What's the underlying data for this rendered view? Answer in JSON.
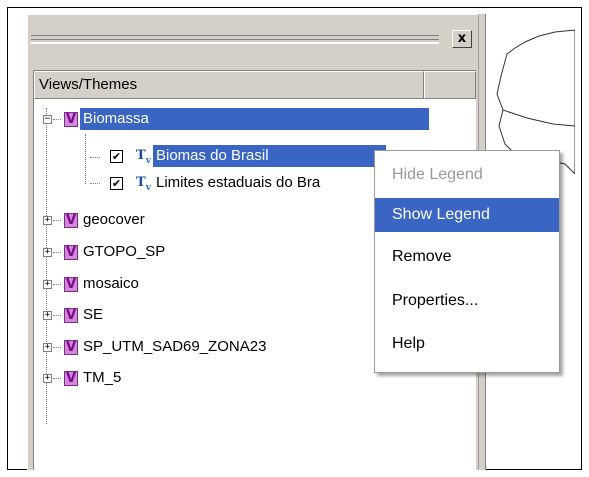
{
  "panel": {
    "close_glyph": "x",
    "column_header": "Views/Themes"
  },
  "tree": {
    "items": [
      {
        "label": "Biomassa",
        "icon": "view-icon",
        "expanded": true,
        "selected": true
      },
      {
        "label": "Biomas do Brasil",
        "icon": "theme-icon",
        "checked": true,
        "selected": true
      },
      {
        "label": "Limites estaduais do Bra",
        "icon": "theme-icon",
        "checked": true
      },
      {
        "label": "geocover",
        "icon": "view-icon",
        "expanded": false
      },
      {
        "label": "GTOPO_SP",
        "icon": "view-icon",
        "expanded": false
      },
      {
        "label": "mosaico",
        "icon": "view-icon",
        "expanded": false
      },
      {
        "label": "SE",
        "icon": "view-icon",
        "expanded": false
      },
      {
        "label": "SP_UTM_SAD69_ZONA23",
        "icon": "view-icon",
        "expanded": false
      },
      {
        "label": "TM_5",
        "icon": "view-icon",
        "expanded": false
      }
    ],
    "view_glyph": "V",
    "theme_glyph": "T",
    "theme_sub": "v",
    "check_glyph": "✔",
    "expand_minus": "−",
    "expand_plus": "+"
  },
  "context_menu": {
    "items": [
      {
        "label": "Hide Legend",
        "state": "disabled"
      },
      {
        "label": "Show Legend",
        "state": "highlighted"
      },
      {
        "label": "Remove",
        "state": "normal"
      },
      {
        "label": "Properties...",
        "state": "normal"
      },
      {
        "label": "Help",
        "state": "normal"
      }
    ]
  },
  "colors": {
    "selection": "#3a65c4",
    "view_icon": "#d08ad8",
    "theme_icon": "#1a4fa0",
    "panel_bg": "#d4d0c8"
  }
}
